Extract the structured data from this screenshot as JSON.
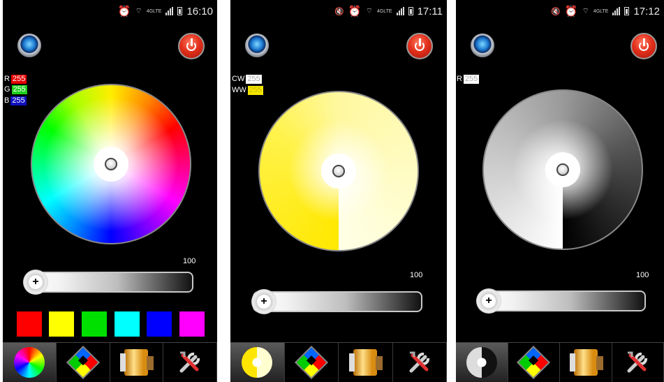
{
  "screens": [
    {
      "status": {
        "time": "16:10",
        "network": "4GLTE"
      },
      "channels": [
        {
          "letter": "R",
          "value": "255",
          "color": "#e60000"
        },
        {
          "letter": "G",
          "value": "255",
          "color": "#1fcf1f"
        },
        {
          "letter": "B",
          "value": "255",
          "color": "#1010c0"
        }
      ],
      "brightness": "100",
      "slider_level": 0.0,
      "swatches": [
        "#ff0000",
        "#ffff00",
        "#00e000",
        "#00ffff",
        "#0000ff",
        "#ff00ff"
      ],
      "active_tab": "color-wheel"
    },
    {
      "status": {
        "time": "17:11",
        "network": "4GLTE"
      },
      "channels": [
        {
          "letter": "CW",
          "value": "255",
          "color": "#ffffff"
        },
        {
          "letter": "WW",
          "value": "255",
          "color": "#f5e600"
        }
      ],
      "brightness": "100",
      "slider_level": 0.0,
      "active_tab": "white-wheel"
    },
    {
      "status": {
        "time": "17:12",
        "network": "4GLTE"
      },
      "channels": [
        {
          "letter": "R",
          "value": "255",
          "color": "#ffffff"
        }
      ],
      "brightness": "100",
      "slider_level": 0.0,
      "active_tab": "mono-wheel"
    }
  ],
  "tabs": [
    "color-wheel-tab",
    "modes-tab",
    "music-tab",
    "settings-tab"
  ],
  "slider_thumb_symbol": "+",
  "icons": {
    "eye": "blue-eye-icon",
    "power": "power-icon"
  }
}
